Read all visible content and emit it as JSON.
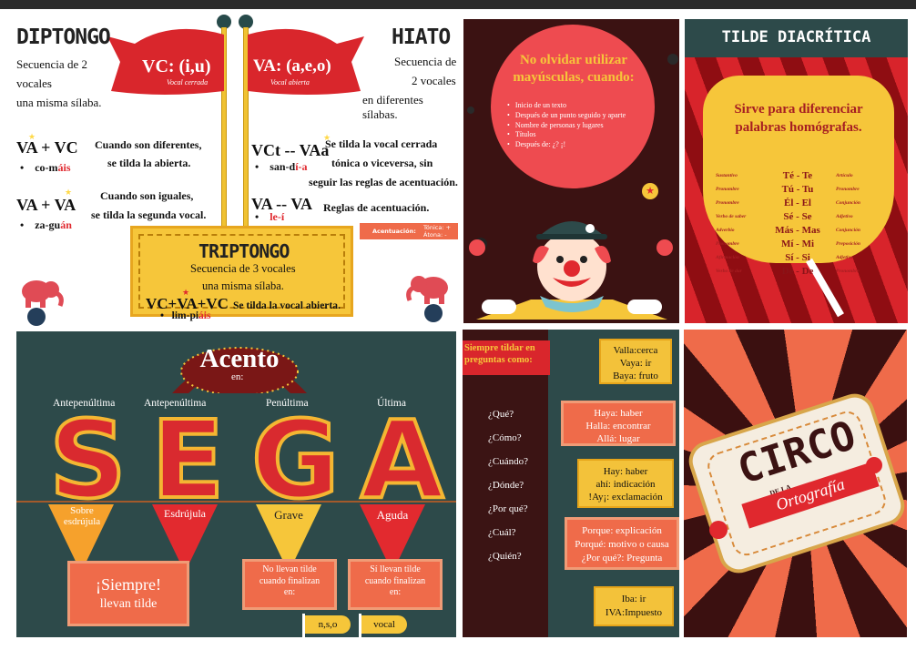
{
  "colors": {
    "red": "#e0282e",
    "yellow": "#f6c63a",
    "teal": "#2d4a4a",
    "maroon": "#3b1212",
    "coral": "#ef6b4a"
  },
  "diptongo": {
    "title": "DIPTONGO",
    "desc_1": "Secuencia de 2",
    "desc_2": "vocales",
    "desc_3": "una misma sílaba.",
    "flag_main": "VC: (i,u)",
    "flag_sub": "Vocal cerrada",
    "rule1_formula": "VA + VC",
    "rule1_text_1": "Cuando son diferentes,",
    "rule1_text_2": "se tilda la abierta.",
    "rule1_example_a": "co-m",
    "rule1_example_b": "áis",
    "rule2_formula": "VA + VA",
    "rule2_text_1": "Cuando son iguales,",
    "rule2_text_2": "se tilda la segunda vocal.",
    "rule2_example_a": "za-gu",
    "rule2_example_b": "án"
  },
  "hiato": {
    "title": "HIATO",
    "desc_1": "Secuencia de",
    "desc_2": "2 vocales",
    "desc_3": "en diferentes sílabas.",
    "flag_main": "VA: (a,e,o)",
    "flag_sub": "Vocal abierta",
    "rule1_formula": "VCt -- VAa",
    "rule1_text_1": "Se tilda la vocal cerrada",
    "rule1_text_2": "tónica o viceversa, sin",
    "rule1_text_3": "seguir las reglas de acentuación.",
    "rule1_example_a": "san-d",
    "rule1_example_b": "í-a",
    "rule2_formula": "VA -- VA",
    "rule2_text": "Reglas de acentuación.",
    "rule2_example": "le-í",
    "legend_label": "Acentuación:",
    "legend_1": "Tónica: +",
    "legend_2": "Átona: -"
  },
  "triptongo": {
    "title": "TRIPTONGO",
    "desc_1": "Secuencia de 3 vocales",
    "desc_2": "una misma sílaba.",
    "formula": "VC+VA+VC",
    "text": "Se tilda la vocal abierta.",
    "example_a": "lim-pi",
    "example_b": "áis"
  },
  "mayusculas": {
    "title": "No olvidar utilizar mayúsculas, cuando:",
    "items": [
      "Inicio de un texto",
      "Después de un punto seguido y aparte",
      "Nombre de personas y lugares",
      "Títulos",
      "Después de: ¿? ¡!"
    ]
  },
  "tilde_diacritica": {
    "title": "TILDE DIACRÍTICA",
    "desc": "Sirve para diferenciar palabras homógrafas.",
    "rows": [
      {
        "left": "Sustantivo",
        "pair": "Té - Te",
        "right": "Artículo"
      },
      {
        "left": "Pronombre",
        "pair": "Tú - Tu",
        "right": "Pronombre"
      },
      {
        "left": "Pronombre",
        "pair": "Él - El",
        "right": "Conjunción"
      },
      {
        "left": "Verbo de saber",
        "pair": "Sé - Se",
        "right": "Adjetivo"
      },
      {
        "left": "Adverbio",
        "pair": "Más - Mas",
        "right": "Conjunción"
      },
      {
        "left": "Pronombre",
        "pair": "Mí - Mi",
        "right": "Preposición"
      },
      {
        "left": "Afirmación",
        "pair": "Sí - Si",
        "right": "Adjetivo"
      },
      {
        "left": "Verbo de dar",
        "pair": "Dé - De",
        "right": "Pronombre"
      }
    ]
  },
  "acento": {
    "title": "Acento",
    "subtitle": "en:",
    "labels": [
      "Antepenúltima",
      "Antepenúltima",
      "Penúltima",
      "Última"
    ],
    "letters": [
      "S",
      "E",
      "G",
      "A"
    ],
    "types": [
      "Sobre esdrújula",
      "Esdrújula",
      "Grave",
      "Aguda"
    ],
    "always_1": "¡Siempre!",
    "always_2": "llevan tilde",
    "grave_rule_1": "No llevan tilde",
    "grave_rule_2": "cuando finalizan",
    "grave_rule_3": "en:",
    "aguda_rule_1": "Sí llevan tilde",
    "aguda_rule_2": "cuando finalizan",
    "aguda_rule_3": "en:",
    "flag_1": "n,s,o",
    "flag_2": "vocal"
  },
  "preguntas": {
    "banner_1": "Siempre tildar en",
    "banner_2": "preguntas como:",
    "questions": [
      "¿Qué?",
      "¿Cómo?",
      "¿Cuándo?",
      "¿Dónde?",
      "¿Por qué?",
      "¿Cuál?",
      "¿Quién?"
    ],
    "box1": [
      "Valla:cerca",
      "Vaya: ir",
      "Baya: fruto"
    ],
    "box2": [
      "Haya: haber",
      "Halla: encontrar",
      "Allá: lugar"
    ],
    "box3": [
      "Hay: haber",
      "ahí: indicación",
      "!Ay¡: exclamación"
    ],
    "box4": [
      "Porque: explicación",
      "Porqué: motivo o causa",
      "¿Por qué?: Pregunta"
    ],
    "box5": [
      "Iba: ir",
      "IVA:Impuesto"
    ]
  },
  "circo": {
    "title": "CIRCO",
    "de_la": "DE LA",
    "subtitle": "Ortografía"
  }
}
